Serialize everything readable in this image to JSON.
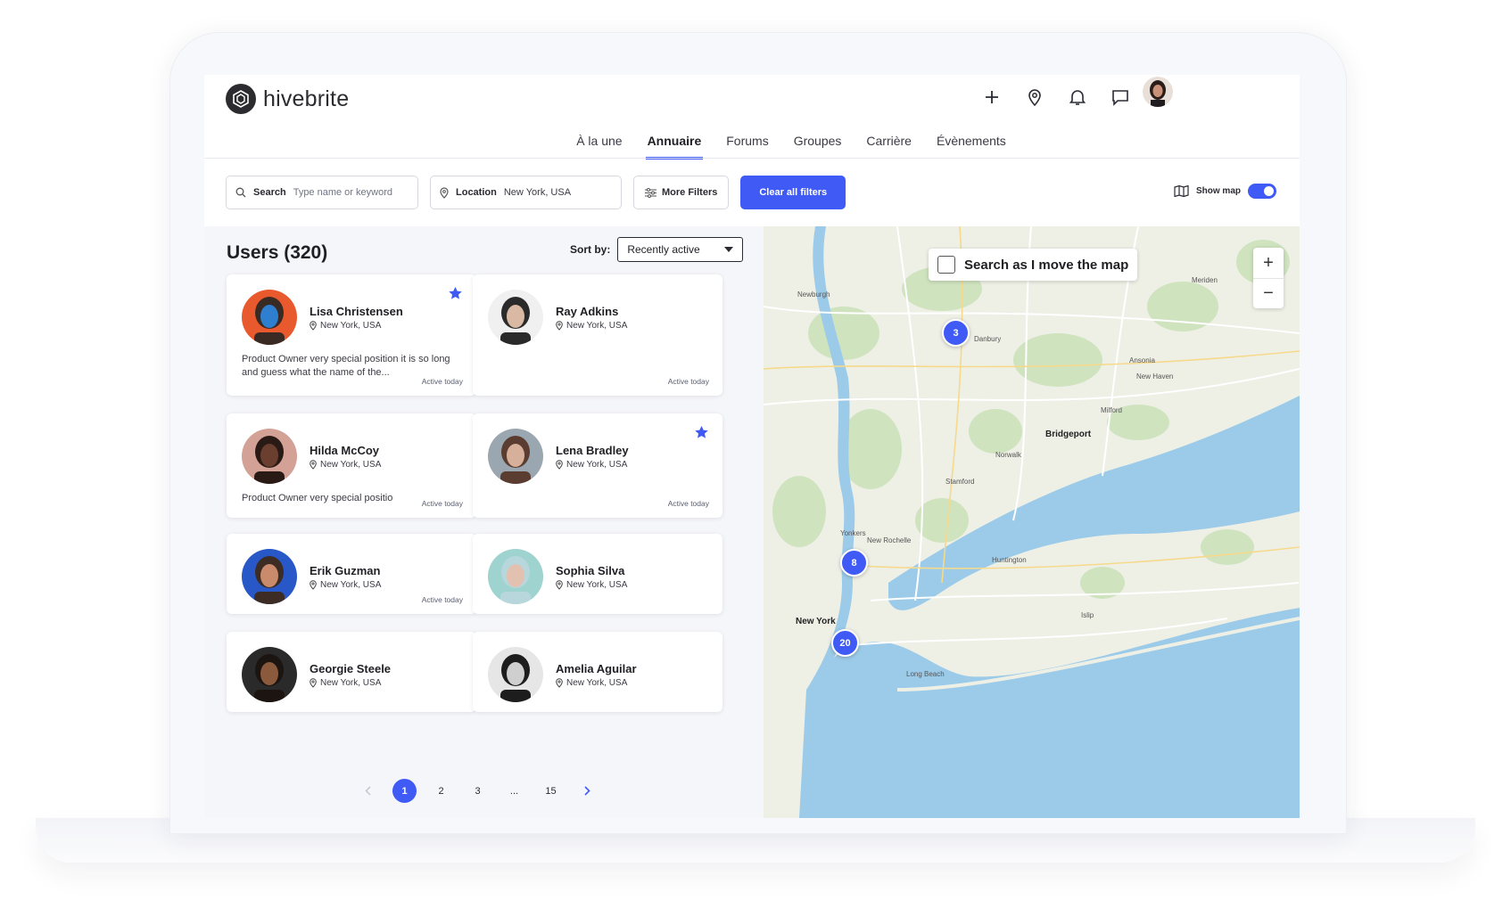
{
  "brand": {
    "name": "hivebrite"
  },
  "nav": {
    "items": [
      "À la une",
      "Annuaire",
      "Forums",
      "Groupes",
      "Carrière",
      "Évènements"
    ],
    "active_index": 1
  },
  "header_icons": [
    "plus-icon",
    "location-pin-icon",
    "bell-icon",
    "chat-icon"
  ],
  "filters": {
    "search_label": "Search",
    "search_placeholder": "Type name or keyword",
    "location_label": "Location",
    "location_value": "New York, USA",
    "more_filters": "More Filters",
    "clear_all": "Clear all filters",
    "show_map": "Show map",
    "show_map_on": true
  },
  "list": {
    "title": "Users (320)",
    "sort_label": "Sort by:",
    "sort_value": "Recently active",
    "users": [
      {
        "name": "Lisa Christensen",
        "location": "New York, USA",
        "bio": "Product Owner very special position it is so long and guess what the name of the...",
        "active": "Active today",
        "starred": true
      },
      {
        "name": "Ray Adkins",
        "location": "New York, USA",
        "bio": "",
        "active": "Active today",
        "starred": false
      },
      {
        "name": "Hilda McCoy",
        "location": "New York, USA",
        "bio": "Product Owner very special positio",
        "active": "Active today",
        "starred": false
      },
      {
        "name": "Lena Bradley",
        "location": "New York, USA",
        "bio": "",
        "active": "Active today",
        "starred": true
      },
      {
        "name": "Erik Guzman",
        "location": "New York, USA",
        "bio": "",
        "active": "Active today",
        "starred": false
      },
      {
        "name": "Sophia Silva",
        "location": "New York, USA",
        "bio": "",
        "active": "",
        "starred": false
      },
      {
        "name": "Georgie Steele",
        "location": "New York, USA",
        "bio": "",
        "active": "",
        "starred": false
      },
      {
        "name": "Amelia Aguilar",
        "location": "New York, USA",
        "bio": "",
        "active": "",
        "starred": false
      }
    ]
  },
  "pagination": {
    "pages": [
      "1",
      "2",
      "3",
      "...",
      "15"
    ],
    "current": "1"
  },
  "map": {
    "search_as_move": "Search as I move the map",
    "clusters": [
      "3",
      "8",
      "20"
    ],
    "labels": [
      "New York",
      "Bridgeport",
      "Danbury",
      "Stamford",
      "Yonkers",
      "New Haven",
      "Newburgh",
      "Huntington",
      "Islip",
      "Norwalk",
      "Meriden",
      "Ansonia",
      "Milford",
      "New Rochelle",
      "Long Beach"
    ]
  },
  "colors": {
    "accent": "#3f5af5",
    "water": "#9ccbe9",
    "land": "#eef0e6",
    "park": "#cfe3bf"
  }
}
